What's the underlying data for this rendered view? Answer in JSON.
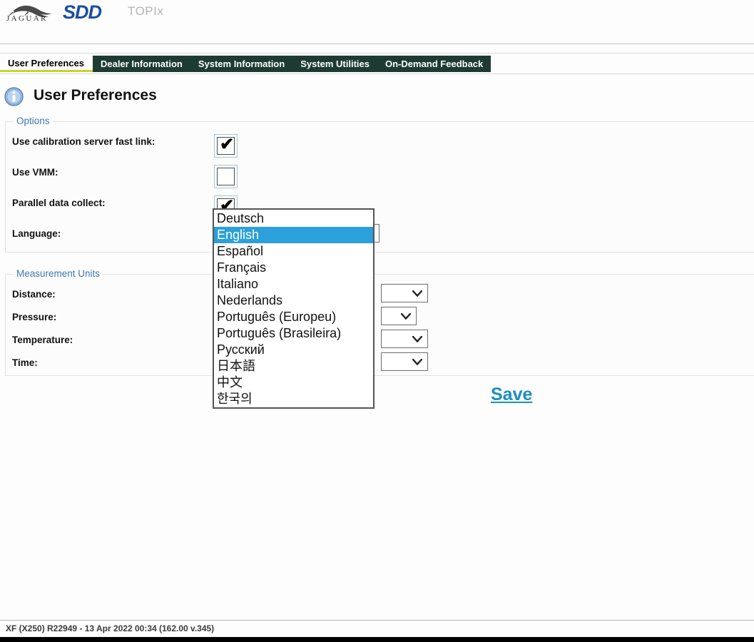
{
  "brand": {
    "jaguar_wordmark": "JAGUAR",
    "sdd_logo": "SDD",
    "topix_logo": "TOPIx",
    "jaguar_icon": "jaguar-leaper-icon"
  },
  "tabs": [
    {
      "label": "User Preferences",
      "active": true
    },
    {
      "label": "Dealer Information",
      "active": false
    },
    {
      "label": "System Information",
      "active": false
    },
    {
      "label": "System Utilities",
      "active": false
    },
    {
      "label": "On-Demand Feedback",
      "active": false
    }
  ],
  "page": {
    "title": "User Preferences",
    "info_icon": "info-circle-icon"
  },
  "options": {
    "legend": "Options",
    "rows": [
      {
        "label": "Use calibration server fast link:",
        "checked": true
      },
      {
        "label": "Use VMM:",
        "checked": false
      },
      {
        "label": "Parallel data collect:",
        "checked": true
      },
      {
        "label": "Language:",
        "checked": null
      }
    ],
    "check_glyph": "✔"
  },
  "language_dropdown": {
    "open": true,
    "selected": "English",
    "options": [
      "Deutsch",
      "English",
      "Español",
      "Français",
      "Italiano",
      "Nederlands",
      "Português (Europeu)",
      "Português (Brasileira)",
      "Русский",
      "日本語",
      "中文",
      "한국의"
    ]
  },
  "measurement_units": {
    "legend": "Measurement Units",
    "rows": [
      {
        "label": "Distance:",
        "value": ""
      },
      {
        "label": "Pressure:",
        "value": ""
      },
      {
        "label": "Temperature:",
        "value": ""
      },
      {
        "label": "Time:",
        "value": ""
      }
    ],
    "chevron_icon": "chevron-down-icon"
  },
  "actions": {
    "save_label": "Save"
  },
  "footer": {
    "status": "XF (X250) R22949 - 13 Apr 2022 00:34 (162.00 v.345)"
  },
  "colors": {
    "tab_bar": "#1d3b32",
    "tab_active_underline": "#c8d42a",
    "legend_blue": "#3e78b2",
    "link_blue": "#1a8fc1",
    "dropdown_selected": "#2ca0da",
    "sdd_blue": "#1a4fa0"
  }
}
